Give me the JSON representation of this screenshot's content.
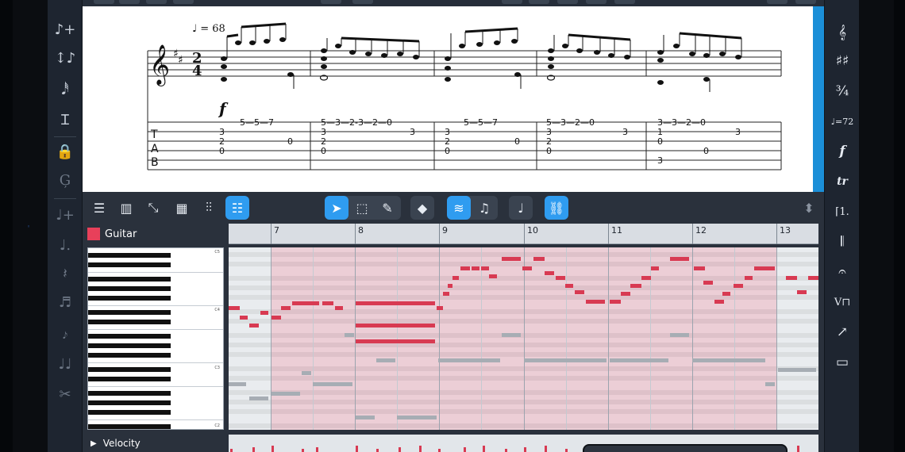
{
  "score": {
    "tempo_marking": "♩ = 68",
    "dynamic": "f",
    "tab_clef": [
      "T",
      "A",
      "B"
    ]
  },
  "tab_numbers": [
    {
      "m": 1,
      "s": 1,
      "t": "5—5—7"
    },
    {
      "m": 1,
      "s": 2,
      "t": "3"
    },
    {
      "m": 1,
      "s": 3,
      "t": "2"
    },
    {
      "m": 1,
      "s": 4,
      "t": "0"
    },
    {
      "m": 2,
      "s": 1,
      "t": "5—3—2-3—2—0"
    },
    {
      "m": 3,
      "s": 1,
      "t": "5—5—7"
    },
    {
      "m": 4,
      "s": 1,
      "t": "5—3—2—0"
    },
    {
      "m": 5,
      "s": 1,
      "t": "3—3—2—0"
    }
  ],
  "lower_toolbar": {
    "buttons": [
      {
        "name": "list-view-button",
        "icon": "≡"
      },
      {
        "name": "piano-view-button",
        "icon": "▥"
      },
      {
        "name": "guitar-view-button",
        "icon": "🎸"
      },
      {
        "name": "grid-view-button",
        "icon": "▦"
      },
      {
        "name": "mixer-button",
        "icon": "⫶"
      },
      {
        "name": "key-editor-button",
        "icon": "☷"
      },
      {
        "name": "select-tool-button",
        "icon": "➤"
      },
      {
        "name": "marquee-tool-button",
        "icon": "⬚"
      },
      {
        "name": "draw-tool-button",
        "icon": "✎"
      },
      {
        "name": "erase-tool-button",
        "icon": "◆"
      },
      {
        "name": "audio-mode-button",
        "icon": "≋"
      },
      {
        "name": "notation-mode-button",
        "icon": "♫"
      },
      {
        "name": "note-value-button",
        "icon": "♩"
      },
      {
        "name": "link-button",
        "icon": "🔗"
      },
      {
        "name": "panel-resize-button",
        "icon": "⬍"
      }
    ]
  },
  "track": {
    "name": "Guitar",
    "color": "#e8405a"
  },
  "ruler": {
    "bars": [
      "7",
      "8",
      "9",
      "10",
      "11",
      "12",
      "13"
    ]
  },
  "keyboard": {
    "labels": [
      "C5",
      "C4",
      "C3",
      "C2"
    ]
  },
  "velocity": {
    "label": "Velocity"
  },
  "left_toolbar": {
    "icons": [
      "note-input-icon",
      "transpose-icon",
      "lute-icon",
      "tuplet-icon",
      "lock-icon",
      "string-icon",
      "insert-note-icon",
      "dotted-note-icon",
      "rest-icon",
      "beamed-notes-icon",
      "grace-note-icon",
      "tied-notes-icon",
      "scissors-icon"
    ]
  },
  "right_toolbar": {
    "icons": [
      "clef-icon",
      "key-signature-icon",
      "time-signature-icon",
      "tempo-icon",
      "dynamics-icon",
      "trill-icon",
      "repeat-ending-icon",
      "bar-lines-icon",
      "fermata-icon",
      "bowing-icon",
      "line-arrow-icon",
      "comment-icon"
    ],
    "glyphs": [
      "𝄞",
      "♯♯",
      "¾",
      "♩=72",
      "𝆑",
      "𝆖",
      "ℿ",
      "𝄂",
      "𝄐",
      "∨⊓",
      "↗",
      "💬"
    ]
  }
}
